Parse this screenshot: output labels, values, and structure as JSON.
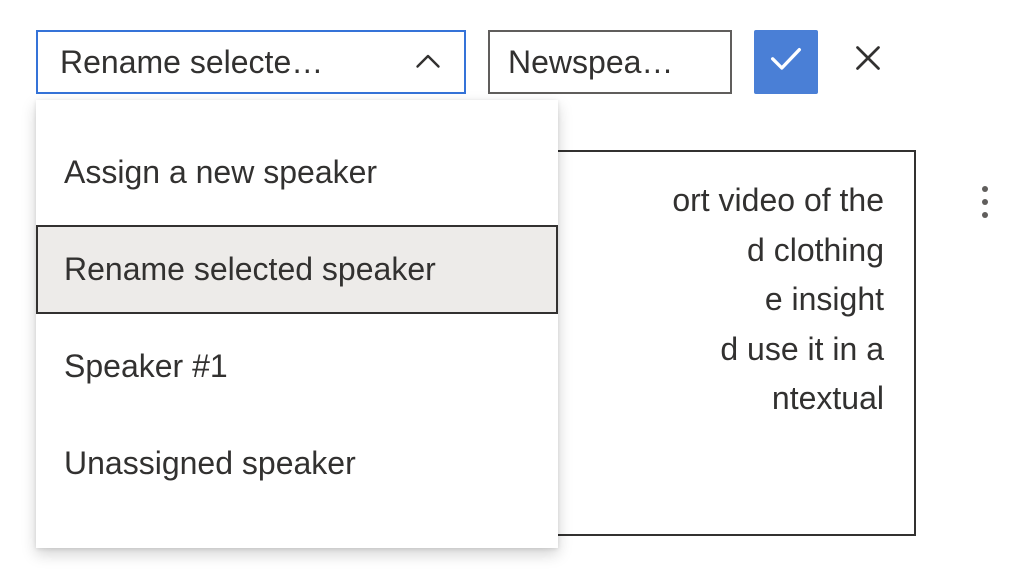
{
  "toolbar": {
    "dropdown_display": "Rename selecte…",
    "dropdown_selected": "Rename selected speaker",
    "input_value": "Newspea…",
    "confirm_accessible": "Confirm",
    "cancel_accessible": "Cancel"
  },
  "dropdown": {
    "options": [
      {
        "label": "Assign a new speaker",
        "selected": false
      },
      {
        "label": "Rename selected speaker",
        "selected": true
      },
      {
        "label": "Speaker #1",
        "selected": false
      },
      {
        "label": "Unassigned speaker",
        "selected": false
      }
    ]
  },
  "content": {
    "line1": "ort video of the",
    "line2": "d clothing",
    "line3": "e insight",
    "line4": "d use it in a",
    "line5": "ntextual"
  },
  "more_accessible": "More options"
}
